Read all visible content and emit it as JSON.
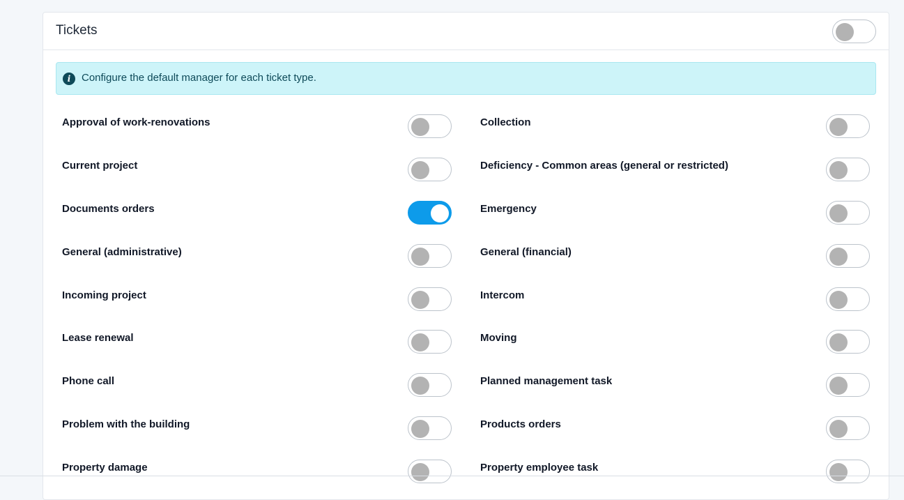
{
  "card": {
    "title": "Tickets",
    "enabled": false
  },
  "alert": {
    "icon": "info-icon",
    "text": "Configure the default manager for each ticket type."
  },
  "ticket_types": [
    {
      "label": "Approval of work-renovations",
      "enabled": false
    },
    {
      "label": "Collection",
      "enabled": false
    },
    {
      "label": "Current project",
      "enabled": false
    },
    {
      "label": "Deficiency - Common areas (general or restricted)",
      "enabled": false
    },
    {
      "label": "Documents orders",
      "enabled": true
    },
    {
      "label": "Emergency",
      "enabled": false
    },
    {
      "label": "General (administrative)",
      "enabled": false
    },
    {
      "label": "General (financial)",
      "enabled": false
    },
    {
      "label": "Incoming project",
      "enabled": false
    },
    {
      "label": "Intercom",
      "enabled": false
    },
    {
      "label": "Lease renewal",
      "enabled": false
    },
    {
      "label": "Moving",
      "enabled": false
    },
    {
      "label": "Phone call",
      "enabled": false
    },
    {
      "label": "Planned management task",
      "enabled": false
    },
    {
      "label": "Problem with the building",
      "enabled": false
    },
    {
      "label": "Products orders",
      "enabled": false
    },
    {
      "label": "Property damage",
      "enabled": false
    },
    {
      "label": "Property employee task",
      "enabled": false
    }
  ],
  "colors": {
    "toggle_on": "#0d9bea",
    "toggle_off_knob": "#b3b3b3",
    "alert_bg": "#cdf4f9",
    "alert_text": "#0e4a59"
  }
}
